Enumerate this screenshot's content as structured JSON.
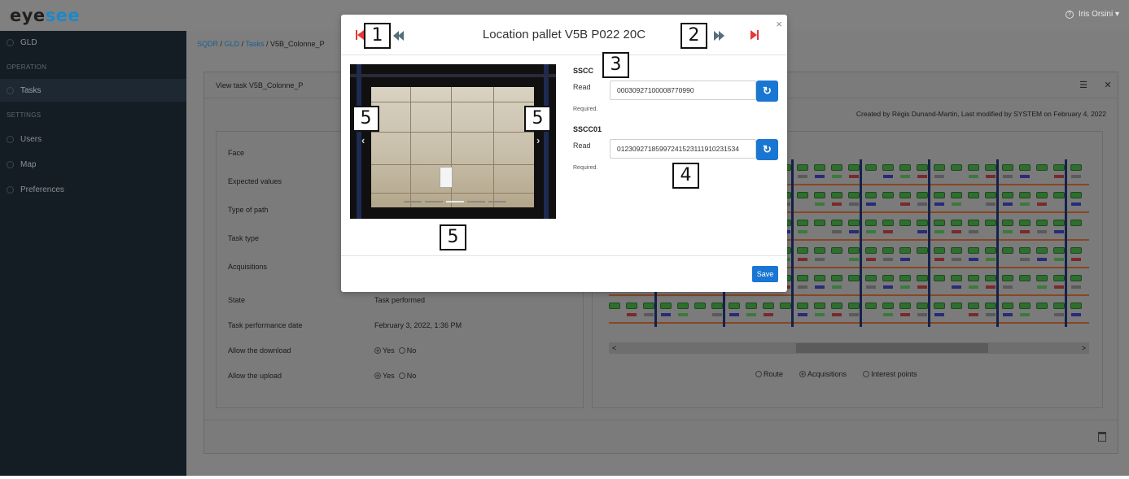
{
  "app": {
    "logo_part1": "eye",
    "logo_part2": "see",
    "user_name": "Iris Orsini ▾",
    "help_glyph": "?"
  },
  "sidebar": {
    "items": [
      {
        "label": "GLD",
        "icon": "circle-icon"
      },
      {
        "label": "Tasks",
        "icon": "circle-icon"
      },
      {
        "label": "Users",
        "icon": "users-icon"
      },
      {
        "label": "Map",
        "icon": "map-icon"
      },
      {
        "label": "Preferences",
        "icon": "gear-icon"
      }
    ],
    "sections": {
      "operation": "OPERATION",
      "settings": "SETTINGS"
    }
  },
  "breadcrumb": {
    "items": [
      "SQDR",
      "GLD",
      "Tasks",
      "V5B_Colonne_P"
    ],
    "sep": "/"
  },
  "panel": {
    "title": "View task V5B_Colonne_P",
    "created_by": "Created by Régis Dunand-Martin, Last modified by SYSTEM on February 4, 2022",
    "list_icon": "list-icon",
    "close_icon": "close-icon"
  },
  "form": {
    "fields": [
      {
        "label": "Face",
        "value": ""
      },
      {
        "label": "Expected values",
        "value": ""
      },
      {
        "label": "Type of path",
        "value": ""
      },
      {
        "label": "Task type",
        "value": ""
      },
      {
        "label": "Acquisitions",
        "value": ""
      },
      {
        "label": "State",
        "value": "Task performed"
      },
      {
        "label": "Task performance date",
        "value": "February 3, 2022, 1:36 PM"
      }
    ],
    "download": {
      "label": "Allow the download",
      "yes": "Yes",
      "no": "No",
      "selected": "Yes"
    },
    "upload": {
      "label": "Allow the upload",
      "yes": "Yes",
      "no": "No",
      "selected": "Yes"
    }
  },
  "map": {
    "radios": [
      {
        "label": "Route",
        "selected": false
      },
      {
        "label": "Acquisitions",
        "selected": true
      },
      {
        "label": "Interest points",
        "selected": false
      }
    ],
    "scroll_left": "<",
    "scroll_right": ">"
  },
  "modal": {
    "title": "Location pallet V5B P022 20C",
    "close": "×",
    "fields": [
      {
        "name": "SSCC",
        "read_label": "Read",
        "value": "00030927100008770990",
        "help": "Required."
      },
      {
        "name": "SSCC01",
        "read_label": "Read",
        "value": "01230927185997241523111910231534",
        "help": "Required."
      }
    ],
    "refresh_glyph": "↻",
    "save_label": "Save",
    "photo_prev": "‹",
    "photo_next": "›",
    "carousel_slides": 5,
    "carousel_current": 3
  },
  "annotations": {
    "a1": "1",
    "a2": "2",
    "a3": "3",
    "a4": "4",
    "a5": "5"
  },
  "colors": {
    "accent": "#1976d2",
    "nav_red": "#e53935",
    "nav_gray": "#546e7a",
    "sidebar_bg": "#151d24",
    "logo_blue": "#1e88c7"
  }
}
